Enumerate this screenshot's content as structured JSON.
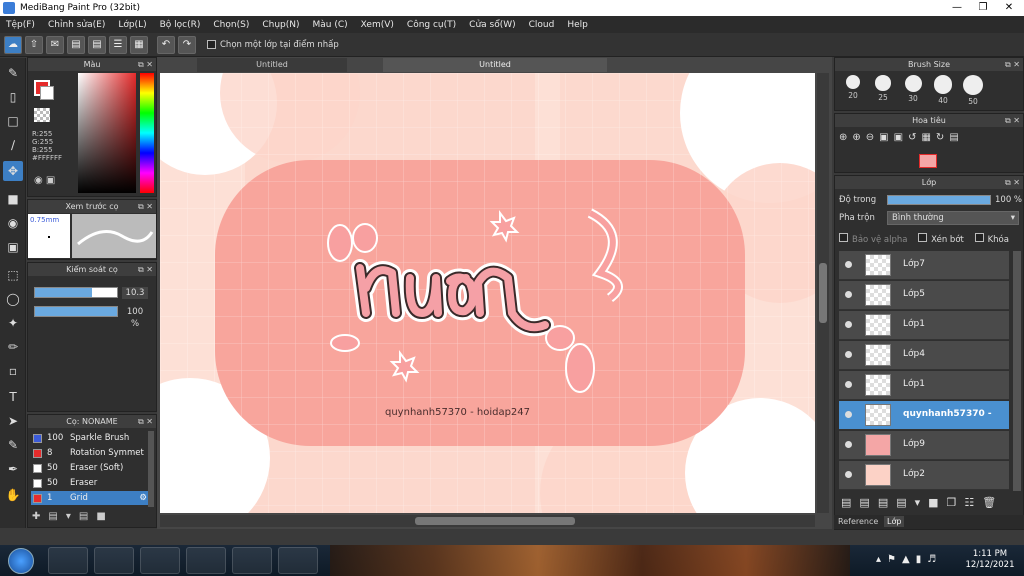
{
  "window": {
    "title": "MediBang Paint Pro (32bit)"
  },
  "menu": [
    "Tệp(F)",
    "Chỉnh sửa(E)",
    "Lớp(L)",
    "Bộ lọc(R)",
    "Chọn(S)",
    "Chụp(N)",
    "Màu (C)",
    "Xem(V)",
    "Công cụ(T)",
    "Cửa sổ(W)",
    "Cloud",
    "Help"
  ],
  "toolbar": {
    "select_layer_label": "Chọn một lớp tại điểm nhấp"
  },
  "color_panel": {
    "title": "Màu",
    "rgb": {
      "r": "R:255",
      "g": "G:255",
      "b": "B:255"
    },
    "hex": "#FFFFFF",
    "foreground": "#e52b2b",
    "background": "#ffffff"
  },
  "preview_panel": {
    "title": "Xem trước cọ",
    "size": "0.75mm"
  },
  "control_panel": {
    "title": "Kiểm soát cọ",
    "size_value": "10.3",
    "size_fraction": 0.7,
    "opacity_value": "100 %",
    "opacity_fraction": 1.0
  },
  "brush_panel": {
    "title": "Cọ: NONAME",
    "items": [
      {
        "color": "#3b5bd8",
        "size": "100",
        "name": "Sparkle Brush"
      },
      {
        "color": "#e52b2b",
        "size": "8",
        "name": "Rotation Symmet"
      },
      {
        "color": "#ffffff",
        "size": "50",
        "name": "Eraser (Soft)"
      },
      {
        "color": "#ffffff",
        "size": "50",
        "name": "Eraser"
      },
      {
        "color": "#e52b2b",
        "size": "1",
        "name": "Grid"
      }
    ],
    "selected_index": 4
  },
  "tabs": [
    "Untitled",
    "Untitled"
  ],
  "canvas": {
    "caption": "quynhanh57370 - hoidap247"
  },
  "brush_size_panel": {
    "title": "Brush Size",
    "sizes": [
      "20",
      "25",
      "30",
      "40",
      "50"
    ]
  },
  "navigator_panel": {
    "title": "Hoa tiêu"
  },
  "layer_panel": {
    "title": "Lớp",
    "opacity_label": "Độ trong",
    "opacity_value": "100 %",
    "blend_label": "Pha trộn",
    "blend_value": "Bình thường",
    "protect_alpha": "Bảo vệ alpha",
    "clipping": "Xén bớt",
    "lock": "Khóa",
    "layers": [
      {
        "name": "Lớp7",
        "selected": false
      },
      {
        "name": "Lớp5",
        "selected": false
      },
      {
        "name": "Lớp1",
        "selected": false
      },
      {
        "name": "Lớp4",
        "selected": false
      },
      {
        "name": "Lớp1",
        "selected": false
      },
      {
        "name": "quynhanh57370 -",
        "selected": true
      },
      {
        "name": "Lớp9",
        "selected": false
      },
      {
        "name": "Lớp2",
        "selected": false
      }
    ]
  },
  "bottom_tabs": [
    "Reference",
    "Lớp"
  ],
  "taskbar": {
    "time": "1:11 PM",
    "date": "12/12/2021"
  }
}
